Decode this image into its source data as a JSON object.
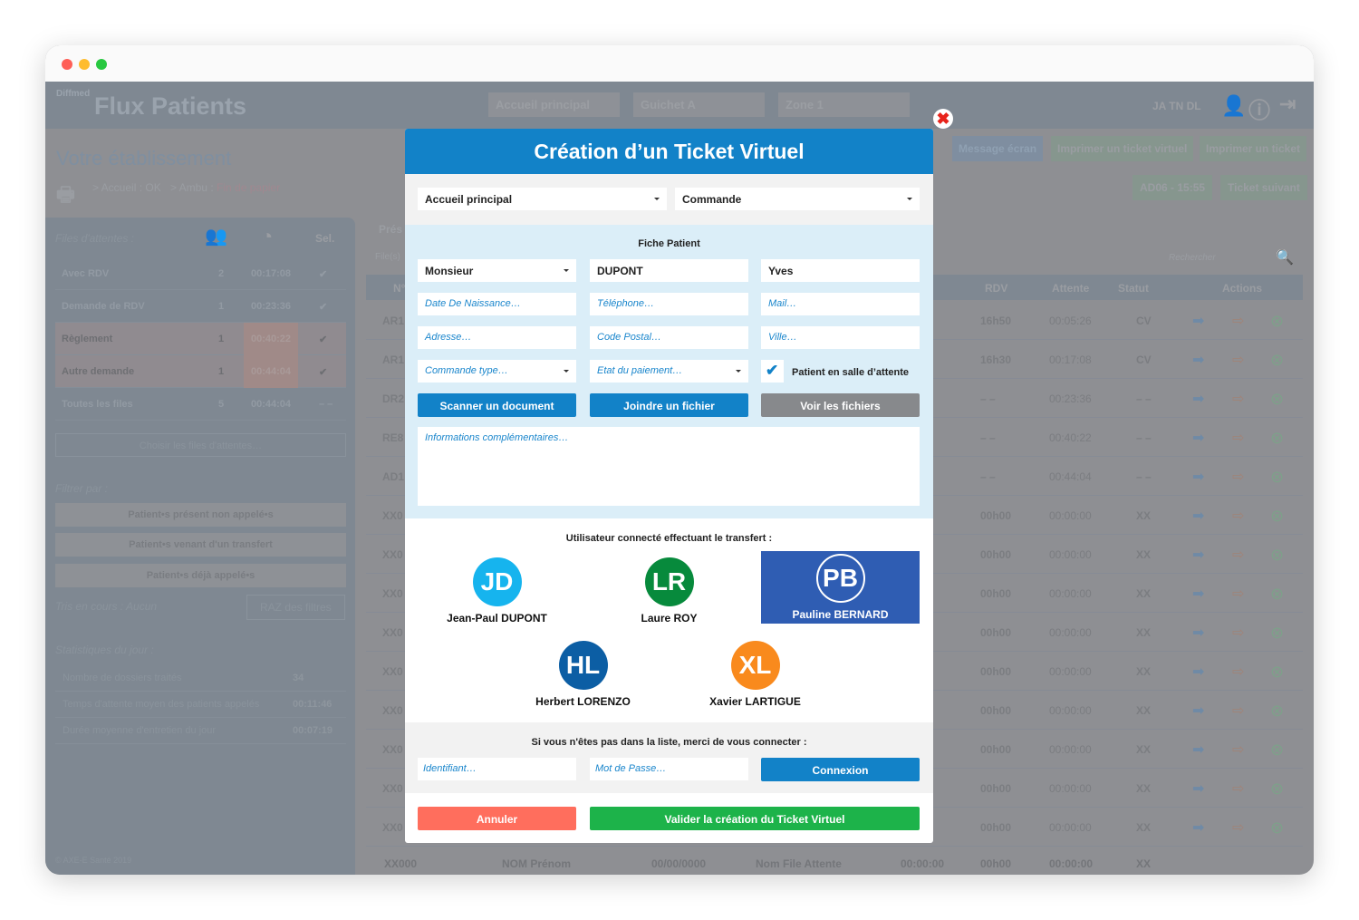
{
  "window": {
    "dots": [
      "#fe5f57",
      "#febc2e",
      "#28c840"
    ]
  },
  "header": {
    "brand_small": "Diffmed",
    "brand": "Flux Patients",
    "selects": [
      "Accueil principal",
      "Guichet A",
      "Zone 1"
    ],
    "user_initials": [
      "JA",
      "TN",
      "DL"
    ]
  },
  "page": {
    "title": "Votre établissement",
    "printer_accueil": "> Accueil : OK",
    "printer_ambu": "> Ambu : ",
    "printer_ambu_status": "Fin de papier",
    "buttons": [
      "Message écran",
      "Imprimer un ticket virtuel",
      "Imprimer un ticket"
    ],
    "current_ticket": "AD06 - 15:55",
    "next_ticket": "Ticket suivant",
    "search_placeholder": "Rechercher",
    "presence": "Prés",
    "files": "File(s)"
  },
  "sidebar": {
    "title": "Files d'attentes :",
    "sel": "Sel.",
    "queues": [
      {
        "name": "Avec RDV",
        "count": "2",
        "time": "00:17:08",
        "sel": "✔"
      },
      {
        "name": "Demande de RDV",
        "count": "1",
        "time": "00:23:36",
        "sel": "✔"
      },
      {
        "name": "Règlement",
        "count": "1",
        "time": "00:40:22",
        "sel": "✔"
      },
      {
        "name": "Autre demande",
        "count": "1",
        "time": "00:44:04",
        "sel": "✔"
      },
      {
        "name": "Toutes les files",
        "count": "5",
        "time": "00:44:04",
        "sel": "– –"
      }
    ],
    "choose": "Choisir les files d'attentes…",
    "filter_title": "Filtrer par :",
    "filters": [
      "Patient•s présent non appelé•s",
      "Patient•s venant d'un transfert",
      "Patient•s déjà appelé•s"
    ],
    "sort_label": "Tris en cours : Aucun",
    "reset": "RAZ des filtres",
    "stats_title": "Statistiques du jour :",
    "stats": [
      {
        "label": "Nombre de dossiers traités",
        "value": "34"
      },
      {
        "label": "Temps d'attente moyen des patients appelés",
        "value": "00:11:46"
      },
      {
        "label": "Durée moyenne d'entretien du jour",
        "value": "00:07:19"
      }
    ],
    "copyright": "© AXE-E Santé 2019"
  },
  "table": {
    "columns": [
      "N°",
      "RDV",
      "Attente",
      "Statut",
      "Actions"
    ],
    "rows": [
      [
        "AR1",
        "16h50",
        "00:05:26",
        "CV"
      ],
      [
        "AR1",
        "16h30",
        "00:17:08",
        "CV"
      ],
      [
        "DR2",
        "– –",
        "00:23:36",
        "– –"
      ],
      [
        "RE8",
        "– –",
        "00:40:22",
        "– –"
      ],
      [
        "AD1",
        "– –",
        "00:44:04",
        "– –"
      ],
      [
        "XX0",
        "00h00",
        "00:00:00",
        "XX"
      ],
      [
        "XX0",
        "00h00",
        "00:00:00",
        "XX"
      ],
      [
        "XX0",
        "00h00",
        "00:00:00",
        "XX"
      ],
      [
        "XX0",
        "00h00",
        "00:00:00",
        "XX"
      ],
      [
        "XX0",
        "00h00",
        "00:00:00",
        "XX"
      ],
      [
        "XX0",
        "00h00",
        "00:00:00",
        "XX"
      ],
      [
        "XX0",
        "00h00",
        "00:00:00",
        "XX"
      ],
      [
        "XX0",
        "00h00",
        "00:00:00",
        "XX"
      ],
      [
        "XX0",
        "00h00",
        "00:00:00",
        "XX"
      ]
    ],
    "last_row": [
      "XX000",
      "NOM Prénom",
      "00/00/0000",
      "Nom File Attente",
      "00:00:00",
      "00h00",
      "00:00:00",
      "XX"
    ]
  },
  "modal": {
    "title": "Création d’un Ticket Virtuel",
    "site": "Accueil principal",
    "motif": "Commande",
    "section": "Fiche Patient",
    "civility": "Monsieur",
    "lastname": "DUPONT",
    "firstname": "Yves",
    "ph": {
      "birth": "Date De Naissance…",
      "phone": "Téléphone…",
      "mail": "Mail…",
      "address": "Adresse…",
      "zip": "Code Postal…",
      "city": "Ville…",
      "order_type": "Commande type…",
      "payment": "Etat du paiement…",
      "info": "Informations complémentaires…",
      "login": "Identifiant…",
      "password": "Mot de Passe…"
    },
    "waiting_room": "Patient en salle d’attente",
    "waiting_checked": true,
    "scan": "Scanner un document",
    "attach": "Joindre un fichier",
    "view": "Voir les fichiers",
    "users_title": "Utilisateur connecté effectuant le transfert :",
    "users": [
      {
        "initials": "JD",
        "name": "Jean-Paul DUPONT",
        "color": "#16b4ee"
      },
      {
        "initials": "LR",
        "name": "Laure ROY",
        "color": "#078a3c"
      },
      {
        "initials": "PB",
        "name": "Pauline BERNARD",
        "color": "#2f5db3",
        "selected": true
      },
      {
        "initials": "HL",
        "name": "Herbert LORENZO",
        "color": "#0c5ea4"
      },
      {
        "initials": "XL",
        "name": "Xavier LARTIGUE",
        "color": "#f98a1d"
      }
    ],
    "login_title": "Si vous n'êtes pas dans la liste, merci de vous connecter :",
    "connect": "Connexion",
    "cancel": "Annuler",
    "validate": "Valider la création du Ticket Virtuel"
  }
}
